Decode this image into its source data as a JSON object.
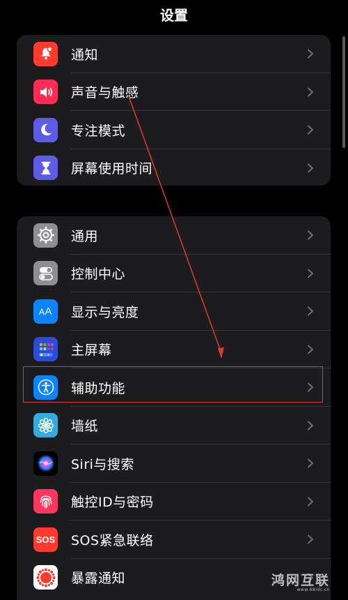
{
  "nav": {
    "title": "设置"
  },
  "group1": [
    {
      "label": "通知",
      "icon": "bell-icon",
      "color": "#ff3b30"
    },
    {
      "label": "声音与触感",
      "icon": "speaker-icon",
      "color": "#ff2d55"
    },
    {
      "label": "专注模式",
      "icon": "moon-icon",
      "color": "#5e5ce6"
    },
    {
      "label": "屏幕使用时间",
      "icon": "hourglass-icon",
      "color": "#5e5ce6"
    }
  ],
  "group2": [
    {
      "label": "通用",
      "icon": "gear-icon",
      "color": "#8e8e93"
    },
    {
      "label": "控制中心",
      "icon": "toggles-icon",
      "color": "#8e8e93"
    },
    {
      "label": "显示与亮度",
      "icon": "text-size-icon",
      "color": "#0a84ff"
    },
    {
      "label": "主屏幕",
      "icon": "app-grid-icon",
      "color": "#2c4bd8"
    },
    {
      "label": "辅助功能",
      "icon": "accessibility-icon",
      "color": "#0a84ff"
    },
    {
      "label": "墙纸",
      "icon": "flower-icon",
      "color": "#35aadc"
    },
    {
      "label": "Siri与搜索",
      "icon": "siri-icon",
      "color": "#1c1c1e"
    },
    {
      "label": "触控ID与密码",
      "icon": "fingerprint-icon",
      "color": "#ff375f"
    },
    {
      "label": "SOS紧急联络",
      "icon": "sos-icon",
      "color": "#ff3b30"
    },
    {
      "label": "暴露通知",
      "icon": "exposure-icon",
      "color": "#ff3b30"
    }
  ],
  "watermark": {
    "text": "鸿网互联",
    "sub": "www.68idc.cn"
  },
  "colors": {
    "highlight": "#e03a2f",
    "background": "#000000",
    "cell": "#1c1c1e"
  }
}
